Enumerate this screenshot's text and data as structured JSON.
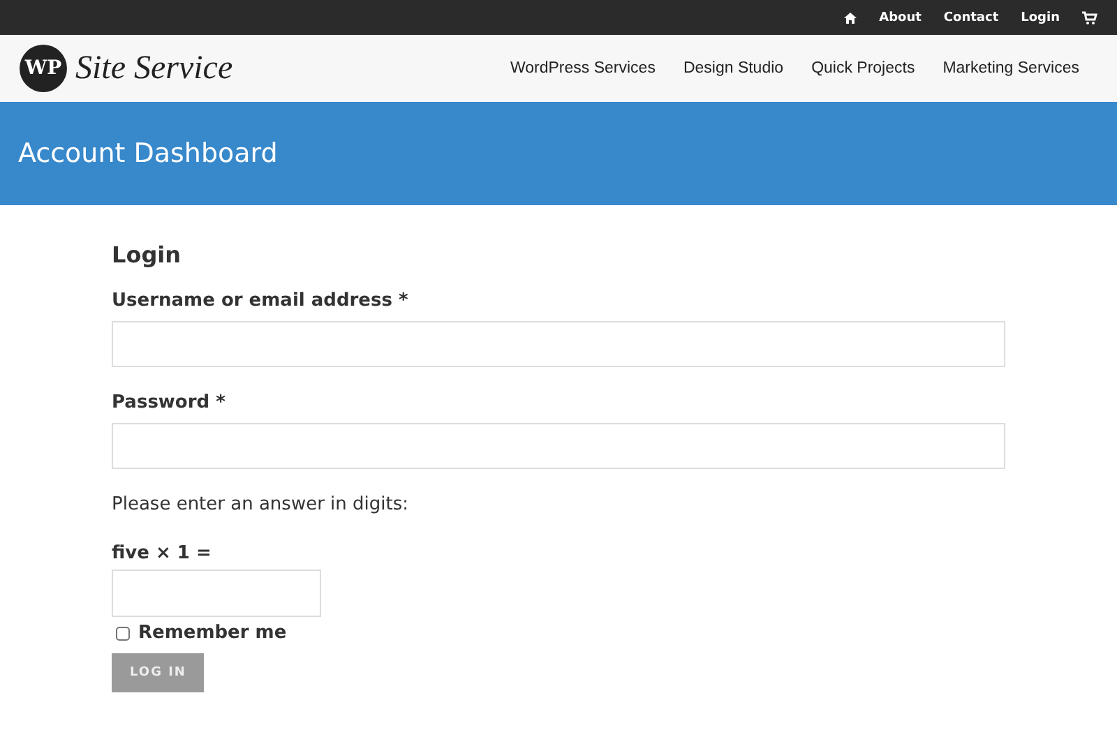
{
  "top_bar": {
    "links": [
      "About",
      "Contact",
      "Login"
    ]
  },
  "header": {
    "logo_badge": "WP",
    "logo_text": "Site Service",
    "nav": [
      "WordPress Services",
      "Design Studio",
      "Quick Projects",
      "Marketing Services"
    ]
  },
  "banner": {
    "title": "Account Dashboard"
  },
  "form": {
    "title": "Login",
    "username": {
      "label": "Username or email address *"
    },
    "password": {
      "label": "Password *"
    },
    "captcha": {
      "hint": "Please enter an answer in digits:",
      "question": "five × 1 ="
    },
    "remember": {
      "label": "Remember me",
      "checked": false
    },
    "submit": "LOG IN"
  }
}
